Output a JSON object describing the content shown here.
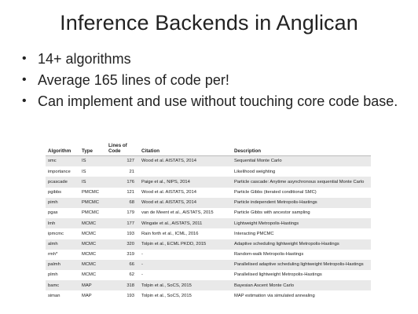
{
  "title": "Inference Backends in Anglican",
  "bullets": [
    "14+ algorithms",
    "Average 165 lines of code per!",
    "Can implement and use without touching core code base."
  ],
  "table": {
    "headers": [
      "Algorithm",
      "Type",
      "Lines of Code",
      "Citation",
      "Description"
    ],
    "rows": [
      [
        "smc",
        "IS",
        "127",
        "Wood et al. AISTATS, 2014",
        "Sequential Monte Carlo"
      ],
      [
        "importance",
        "IS",
        "21",
        "",
        "Likelihood weighting"
      ],
      [
        "pcascade",
        "IS",
        "176",
        "Paige et al., NIPS, 2014",
        "Particle cascade: Anytime asynchronous sequential Monte Carlo"
      ],
      [
        "pgibbs",
        "PMCMC",
        "121",
        "Wood et al. AISTATS, 2014",
        "Particle Gibbs (iterated conditional SMC)"
      ],
      [
        "pimh",
        "PMCMC",
        "68",
        "Wood et al. AISTATS, 2014",
        "Particle independent Metropolis-Hastings"
      ],
      [
        "pgas",
        "PMCMC",
        "179",
        "van de Meent et al., AISTATS, 2015",
        "Particle Gibbs with ancestor sampling"
      ],
      [
        "lmh",
        "MCMC",
        "177",
        "Wingate et al., AISTATS, 2011",
        "Lightweight Metropolis-Hastings"
      ],
      [
        "ipmcmc",
        "MCMC",
        "193",
        "Rain forth et al., ICML, 2016",
        "Interacting PMCMC"
      ],
      [
        "almh",
        "MCMC",
        "320",
        "Tolpin et al., ECML PKDD, 2015",
        "Adaptive scheduling lightweight Metropolis-Hastings"
      ],
      [
        "rmh*",
        "MCMC",
        "319",
        "-",
        "Random-walk Metropolis-Hastings"
      ],
      [
        "palmh",
        "MCMC",
        "66",
        "-",
        "Parallelised adaptive scheduling lightweight Metropolis-Hastings"
      ],
      [
        "plmh",
        "MCMC",
        "62",
        "-",
        "Parallelised lightweight Metropolis-Hastings"
      ],
      [
        "bamc",
        "MAP",
        "318",
        "Tolpin et al., SoCS, 2015",
        "Bayesian Ascent Monte Carlo"
      ],
      [
        "siman",
        "MAP",
        "193",
        "Tolpin et al., SoCS, 2015",
        "MAP estimation via simulated annealing"
      ]
    ]
  }
}
